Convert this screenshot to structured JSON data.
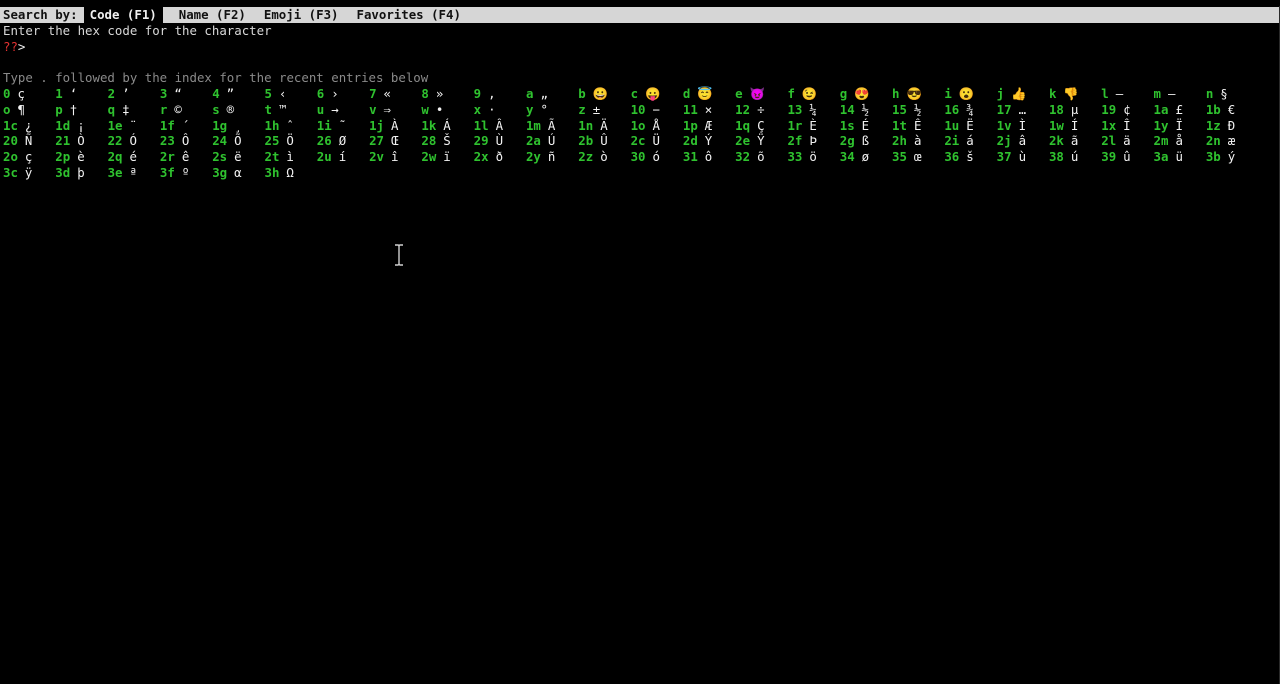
{
  "tabs": {
    "label": "Search by:",
    "items": [
      {
        "label": "Code (F1)",
        "active": true
      },
      {
        "label": "Name (F2)",
        "active": false
      },
      {
        "label": "Emoji (F3)",
        "active": false
      },
      {
        "label": "Favorites (F4)",
        "active": false
      }
    ]
  },
  "prompt": {
    "instruction": "Enter the hex code for the character",
    "marker": "??",
    "arrow": ">"
  },
  "hint": "Type . followed by the index for the recent entries below",
  "recent_entries": [
    {
      "idx": "0",
      "ch": "ç"
    },
    {
      "idx": "1",
      "ch": "‘"
    },
    {
      "idx": "2",
      "ch": "’"
    },
    {
      "idx": "3",
      "ch": "“"
    },
    {
      "idx": "4",
      "ch": "”"
    },
    {
      "idx": "5",
      "ch": "‹"
    },
    {
      "idx": "6",
      "ch": "›"
    },
    {
      "idx": "7",
      "ch": "«"
    },
    {
      "idx": "8",
      "ch": "»"
    },
    {
      "idx": "9",
      "ch": ","
    },
    {
      "idx": "a",
      "ch": "„"
    },
    {
      "idx": "b",
      "ch": "😀"
    },
    {
      "idx": "c",
      "ch": "😛"
    },
    {
      "idx": "d",
      "ch": "😇"
    },
    {
      "idx": "e",
      "ch": "😈"
    },
    {
      "idx": "f",
      "ch": "😉"
    },
    {
      "idx": "g",
      "ch": "😍"
    },
    {
      "idx": "h",
      "ch": "😎"
    },
    {
      "idx": "i",
      "ch": "😮"
    },
    {
      "idx": "j",
      "ch": "👍"
    },
    {
      "idx": "k",
      "ch": "👎"
    },
    {
      "idx": "l",
      "ch": "—"
    },
    {
      "idx": "m",
      "ch": "–"
    },
    {
      "idx": "n",
      "ch": "§"
    },
    {
      "idx": "o",
      "ch": "¶"
    },
    {
      "idx": "p",
      "ch": "†"
    },
    {
      "idx": "q",
      "ch": "‡"
    },
    {
      "idx": "r",
      "ch": "©"
    },
    {
      "idx": "s",
      "ch": "®"
    },
    {
      "idx": "t",
      "ch": "™"
    },
    {
      "idx": "u",
      "ch": "→"
    },
    {
      "idx": "v",
      "ch": "⇒"
    },
    {
      "idx": "w",
      "ch": "•"
    },
    {
      "idx": "x",
      "ch": "·"
    },
    {
      "idx": "y",
      "ch": "°"
    },
    {
      "idx": "z",
      "ch": "±"
    },
    {
      "idx": "10",
      "ch": "−"
    },
    {
      "idx": "11",
      "ch": "×"
    },
    {
      "idx": "12",
      "ch": "÷"
    },
    {
      "idx": "13",
      "ch": "¼"
    },
    {
      "idx": "14",
      "ch": "½"
    },
    {
      "idx": "15",
      "ch": "½"
    },
    {
      "idx": "16",
      "ch": "¾"
    },
    {
      "idx": "17",
      "ch": "…"
    },
    {
      "idx": "18",
      "ch": "µ"
    },
    {
      "idx": "19",
      "ch": "¢"
    },
    {
      "idx": "1a",
      "ch": "£"
    },
    {
      "idx": "1b",
      "ch": "€"
    },
    {
      "idx": "1c",
      "ch": "¿"
    },
    {
      "idx": "1d",
      "ch": "¡"
    },
    {
      "idx": "1e",
      "ch": "¨"
    },
    {
      "idx": "1f",
      "ch": "´"
    },
    {
      "idx": "1g",
      "ch": "¸"
    },
    {
      "idx": "1h",
      "ch": "ˆ"
    },
    {
      "idx": "1i",
      "ch": "˜"
    },
    {
      "idx": "1j",
      "ch": "À"
    },
    {
      "idx": "1k",
      "ch": "Á"
    },
    {
      "idx": "1l",
      "ch": "Â"
    },
    {
      "idx": "1m",
      "ch": "Ã"
    },
    {
      "idx": "1n",
      "ch": "Ä"
    },
    {
      "idx": "1o",
      "ch": "Å"
    },
    {
      "idx": "1p",
      "ch": "Æ"
    },
    {
      "idx": "1q",
      "ch": "Ç"
    },
    {
      "idx": "1r",
      "ch": "È"
    },
    {
      "idx": "1s",
      "ch": "É"
    },
    {
      "idx": "1t",
      "ch": "Ê"
    },
    {
      "idx": "1u",
      "ch": "Ë"
    },
    {
      "idx": "1v",
      "ch": "Ì"
    },
    {
      "idx": "1w",
      "ch": "Í"
    },
    {
      "idx": "1x",
      "ch": "Î"
    },
    {
      "idx": "1y",
      "ch": "Ï"
    },
    {
      "idx": "1z",
      "ch": "Ð"
    },
    {
      "idx": "20",
      "ch": "Ñ"
    },
    {
      "idx": "21",
      "ch": "Ò"
    },
    {
      "idx": "22",
      "ch": "Ó"
    },
    {
      "idx": "23",
      "ch": "Ô"
    },
    {
      "idx": "24",
      "ch": "Õ"
    },
    {
      "idx": "25",
      "ch": "Ö"
    },
    {
      "idx": "26",
      "ch": "Ø"
    },
    {
      "idx": "27",
      "ch": "Œ"
    },
    {
      "idx": "28",
      "ch": "Š"
    },
    {
      "idx": "29",
      "ch": "Ù"
    },
    {
      "idx": "2a",
      "ch": "Ú"
    },
    {
      "idx": "2b",
      "ch": "Û"
    },
    {
      "idx": "2c",
      "ch": "Ü"
    },
    {
      "idx": "2d",
      "ch": "Ý"
    },
    {
      "idx": "2e",
      "ch": "Ÿ"
    },
    {
      "idx": "2f",
      "ch": "Þ"
    },
    {
      "idx": "2g",
      "ch": "ß"
    },
    {
      "idx": "2h",
      "ch": "à"
    },
    {
      "idx": "2i",
      "ch": "á"
    },
    {
      "idx": "2j",
      "ch": "â"
    },
    {
      "idx": "2k",
      "ch": "ã"
    },
    {
      "idx": "2l",
      "ch": "ä"
    },
    {
      "idx": "2m",
      "ch": "å"
    },
    {
      "idx": "2n",
      "ch": "æ"
    },
    {
      "idx": "2o",
      "ch": "ç"
    },
    {
      "idx": "2p",
      "ch": "è"
    },
    {
      "idx": "2q",
      "ch": "é"
    },
    {
      "idx": "2r",
      "ch": "ê"
    },
    {
      "idx": "2s",
      "ch": "ë"
    },
    {
      "idx": "2t",
      "ch": "ì"
    },
    {
      "idx": "2u",
      "ch": "í"
    },
    {
      "idx": "2v",
      "ch": "î"
    },
    {
      "idx": "2w",
      "ch": "ï"
    },
    {
      "idx": "2x",
      "ch": "ð"
    },
    {
      "idx": "2y",
      "ch": "ñ"
    },
    {
      "idx": "2z",
      "ch": "ò"
    },
    {
      "idx": "30",
      "ch": "ó"
    },
    {
      "idx": "31",
      "ch": "ô"
    },
    {
      "idx": "32",
      "ch": "õ"
    },
    {
      "idx": "33",
      "ch": "ö"
    },
    {
      "idx": "34",
      "ch": "ø"
    },
    {
      "idx": "35",
      "ch": "œ"
    },
    {
      "idx": "36",
      "ch": "š"
    },
    {
      "idx": "37",
      "ch": "ù"
    },
    {
      "idx": "38",
      "ch": "ú"
    },
    {
      "idx": "39",
      "ch": "û"
    },
    {
      "idx": "3a",
      "ch": "ü"
    },
    {
      "idx": "3b",
      "ch": "ý"
    },
    {
      "idx": "3c",
      "ch": "ÿ"
    },
    {
      "idx": "3d",
      "ch": "þ"
    },
    {
      "idx": "3e",
      "ch": "ª"
    },
    {
      "idx": "3f",
      "ch": "º"
    },
    {
      "idx": "3g",
      "ch": "α"
    },
    {
      "idx": "3h",
      "ch": "Ω"
    }
  ],
  "colors": {
    "index": "#2fc22f",
    "marker": "#e03131",
    "hint": "#8a8a8a",
    "background": "#000000"
  }
}
